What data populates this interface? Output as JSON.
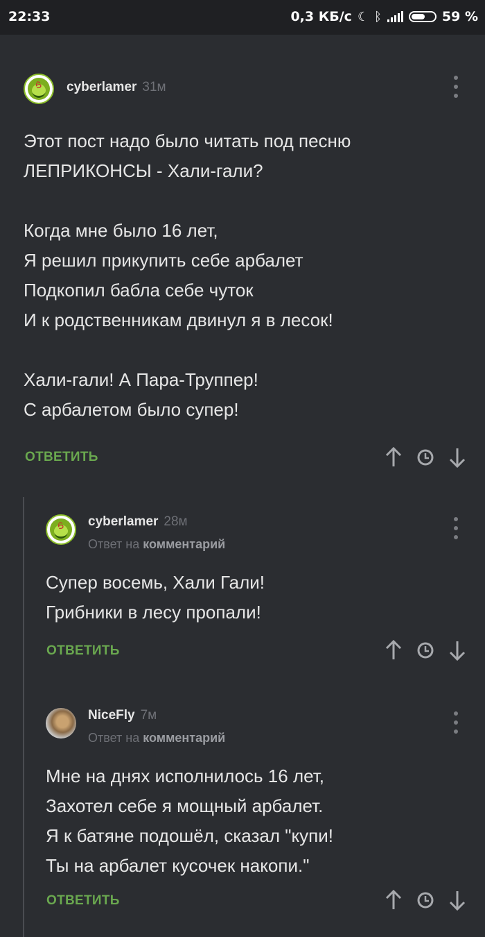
{
  "status": {
    "time": "22:33",
    "speed": "0,3 КБ/с",
    "battery": "59 %",
    "battery_level": 0.59
  },
  "comments": [
    {
      "author": "cyberlamer",
      "age": "31м",
      "avatar_icon": "smiley-avatar-icon",
      "text": "Этот пост надо было читать под песню\nЛЕПРИКОНСЫ - Хали-гали?\n\nКогда мне было 16 лет,\nЯ решил прикупить себе арбалет\nПодкопил бабла себе чуток\nИ к родственникам двинул я в лесок!\n\nХали-гали! А Пара-Труппер!\nС арбалетом было супер!",
      "reply_label": "ОТВЕТИТЬ"
    },
    {
      "author": "cyberlamer",
      "age": "28м",
      "avatar_icon": "smiley-avatar-icon",
      "reply_prefix": "Ответ на",
      "reply_target": "комментарий",
      "text": "Супер восемь, Хали Гали!\nГрибники в лесу пропали!",
      "reply_label": "ОТВЕТИТЬ"
    },
    {
      "author": "NiceFly",
      "age": "7м",
      "avatar_icon": "photo-avatar-icon",
      "reply_prefix": "Ответ на",
      "reply_target": "комментарий",
      "text": "Мне на днях исполнилось 16 лет,\nЗахотел себе я мощный арбалет.\nЯ к батяне подошёл, сказал \"купи!\nТы на арбалет кусочек накопи.\"",
      "reply_label": "ОТВЕТИТЬ"
    }
  ],
  "colors": {
    "background": "#2b2d31",
    "reply_green": "#6aa84f",
    "muted": "#6e7076"
  }
}
